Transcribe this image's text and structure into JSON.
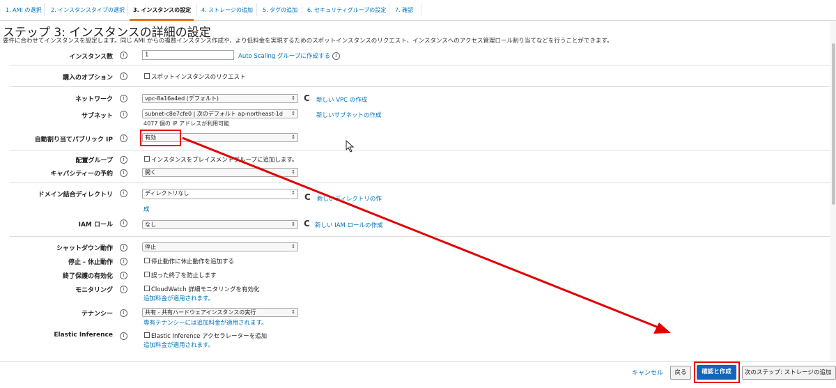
{
  "wizard_tabs": [
    {
      "label": "1. AMI の選択"
    },
    {
      "label": "2. インスタンスタイプの選択"
    },
    {
      "label": "3. インスタンスの設定"
    },
    {
      "label": "4. ストレージの追加"
    },
    {
      "label": "5. タグの追加"
    },
    {
      "label": "6. セキュリティグループの設定"
    },
    {
      "label": "7. 確認"
    }
  ],
  "page": {
    "title": "ステップ 3: インスタンスの詳細の設定",
    "description": "要件に合わせてインスタンスを設定します。同じ AMI からの複数インスタンス作成や、より低料金を実現するためのスポットインスタンスのリクエスト、インスタンスへのアクセス管理ロール割り当てなどを行うことができます。"
  },
  "info_glyph": "i",
  "refresh_glyph": "C",
  "select_arrow": "↕",
  "fields": {
    "instance_count": {
      "label": "インスタンス数",
      "value": "1",
      "link": "Auto Scaling グループに作成する"
    },
    "purchase_option": {
      "label": "購入のオプション",
      "checkbox": "スポットインスタンスのリクエスト"
    },
    "network": {
      "label": "ネットワーク",
      "value": "vpc-8a16a4ed (デフォルト)",
      "link": "新しい VPC の作成"
    },
    "subnet": {
      "label": "サブネット",
      "value": "subnet-c8e7cfe0 | 次のデフォルト ap-northeast-1d",
      "note": "4077 個の IP アドレスが利用可能",
      "link": "新しいサブネットの作成"
    },
    "auto_public_ip": {
      "label": "自動割り当てパブリック IP",
      "value": "有効"
    },
    "placement_group": {
      "label": "配置グループ",
      "checkbox": "インスタンスをプレイスメントグループに追加します。"
    },
    "capacity_reservation": {
      "label": "キャパシティーの予約",
      "value": "開く"
    },
    "domain_directory": {
      "label": "ドメイン結合ディレクトリ",
      "value": "ディレクトリなし",
      "link_line1": "新しいディレクトリの作",
      "link_line2": "成"
    },
    "iam_role": {
      "label": "IAM ロール",
      "value": "なし",
      "link": "新しい IAM ロールの作成"
    },
    "shutdown_behavior": {
      "label": "シャットダウン動作",
      "value": "停止"
    },
    "stop_hibernate": {
      "label": "停止 - 休止動作",
      "checkbox": "停止動作に休止動作を追加する"
    },
    "termination_protection": {
      "label": "終了保護の有効化",
      "checkbox": "誤った終了を防止します"
    },
    "monitoring": {
      "label": "モニタリング",
      "checkbox": "CloudWatch 詳細モニタリングを有効化",
      "link": "追加料金が適用されます。"
    },
    "tenancy": {
      "label": "テナンシー",
      "value": "共有 - 共有ハードウェアインスタンスの実行",
      "link": "専有テナンシーには追加料金が適用されます。"
    },
    "elastic_inference": {
      "label": "Elastic Inference",
      "checkbox": "Elastic Inference アクセラレーターを追加",
      "link": "追加料金が適用されます。"
    }
  },
  "footer": {
    "cancel": "キャンセル",
    "back": "戻る",
    "review_launch": "確認と作成",
    "next": "次のステップ: ストレージの追加"
  },
  "colors": {
    "link": "#0073bb",
    "primary_button": "#1166bb",
    "annotation": "#e00000",
    "tab_active_underline": "#ec7211"
  }
}
